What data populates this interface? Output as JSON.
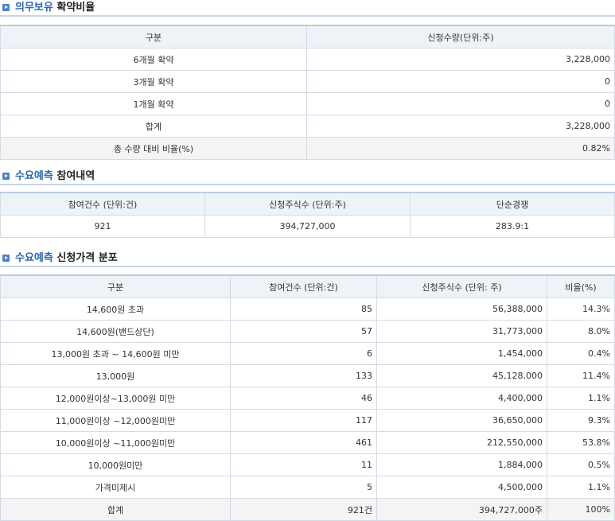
{
  "lockup": {
    "title_highlight": "의무보유",
    "title_rest": "확약비율",
    "headers": [
      "구분",
      "신청수량(단위:주)"
    ],
    "rows": [
      {
        "label": "6개월 확약",
        "value": "3,228,000"
      },
      {
        "label": "3개월 확약",
        "value": "0"
      },
      {
        "label": "1개월 확약",
        "value": "0"
      },
      {
        "label": "합계",
        "value": "3,228,000"
      }
    ],
    "ratio_row": {
      "label": "총 수량 대비 비율(%)",
      "value": "0.82%"
    }
  },
  "participation": {
    "title_highlight": "수요예측",
    "title_rest": "참여내역",
    "headers": [
      "참여건수 (단위:건)",
      "신청주식수 (단위:주)",
      "단순경쟁"
    ],
    "row": [
      "921",
      "394,727,000",
      "283.9:1"
    ]
  },
  "distribution": {
    "title_highlight": "수요예측",
    "title_rest": "신청가격 분포",
    "headers": [
      "구분",
      "참여건수 (단위:건)",
      "신청주식수 (단위: 주)",
      "비율(%)"
    ],
    "rows": [
      [
        "14,600원 초과",
        "85",
        "56,388,000",
        "14.3%"
      ],
      [
        "14,600원(밴드상단)",
        "57",
        "31,773,000",
        "8.0%"
      ],
      [
        "13,000원 초과 ~ 14,600원 미만",
        "6",
        "1,454,000",
        "0.4%"
      ],
      [
        "13,000원",
        "133",
        "45,128,000",
        "11.4%"
      ],
      [
        "12,000원이상~13,000원 미만",
        "46",
        "4,400,000",
        "1.1%"
      ],
      [
        "11,000원이상 ~12,000원미만",
        "117",
        "36,650,000",
        "9.3%"
      ],
      [
        "10,000원이상 ~11,000원미만",
        "461",
        "212,550,000",
        "53.8%"
      ],
      [
        "10,000원미만",
        "11",
        "1,884,000",
        "0.5%"
      ],
      [
        "가격미제시",
        "5",
        "4,500,000",
        "1.1%"
      ]
    ],
    "total": [
      "합계",
      "921건",
      "394,727,000주",
      "100%"
    ]
  },
  "colors": {
    "highlight": "#2a67b5",
    "icon": "#4f82c4",
    "header_bg": "#eef3f8",
    "border": "#d3dbe6"
  }
}
